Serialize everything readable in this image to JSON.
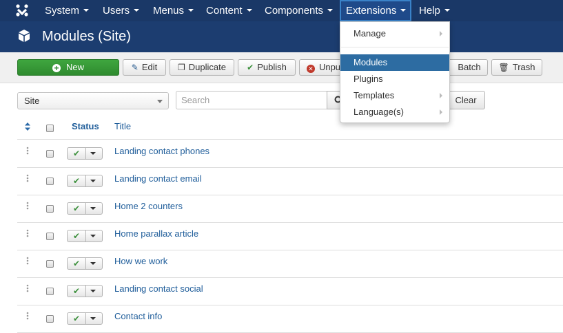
{
  "topnav": {
    "items": [
      {
        "label": "System"
      },
      {
        "label": "Users"
      },
      {
        "label": "Menus"
      },
      {
        "label": "Content"
      },
      {
        "label": "Components"
      },
      {
        "label": "Extensions"
      },
      {
        "label": "Help"
      }
    ],
    "active": "Extensions"
  },
  "header": {
    "icon": "cube-icon",
    "title": "Modules (Site)"
  },
  "toolbar": {
    "new_label": "New",
    "edit_label": "Edit",
    "duplicate_label": "Duplicate",
    "publish_label": "Publish",
    "unpublish_label": "Unpu",
    "batch_label": "Batch",
    "trash_label": "Trash"
  },
  "filters": {
    "client_value": "Site",
    "search_placeholder": "Search",
    "search_value": "",
    "clear_label": "Clear"
  },
  "table": {
    "headers": {
      "status": "Status",
      "title": "Title"
    },
    "rows": [
      {
        "title": "Landing contact phones",
        "published": true
      },
      {
        "title": "Landing contact email",
        "published": true
      },
      {
        "title": "Home 2 counters",
        "published": true
      },
      {
        "title": "Home parallax article",
        "published": true
      },
      {
        "title": "How we work",
        "published": true
      },
      {
        "title": "Landing contact social",
        "published": true
      },
      {
        "title": "Contact info",
        "published": true
      }
    ]
  },
  "extensions_menu": {
    "items": [
      {
        "label": "Manage",
        "submenu": true
      },
      {
        "label": "Modules",
        "submenu": false,
        "active": true
      },
      {
        "label": "Plugins",
        "submenu": false
      },
      {
        "label": "Templates",
        "submenu": true
      },
      {
        "label": "Language(s)",
        "submenu": true
      }
    ]
  },
  "colors": {
    "nav_bg": "#1a3867",
    "header_bg": "#1c3d70",
    "new_button": "#2f8b2f",
    "link": "#1f5d9a",
    "menu_active": "#2d6ca2"
  }
}
